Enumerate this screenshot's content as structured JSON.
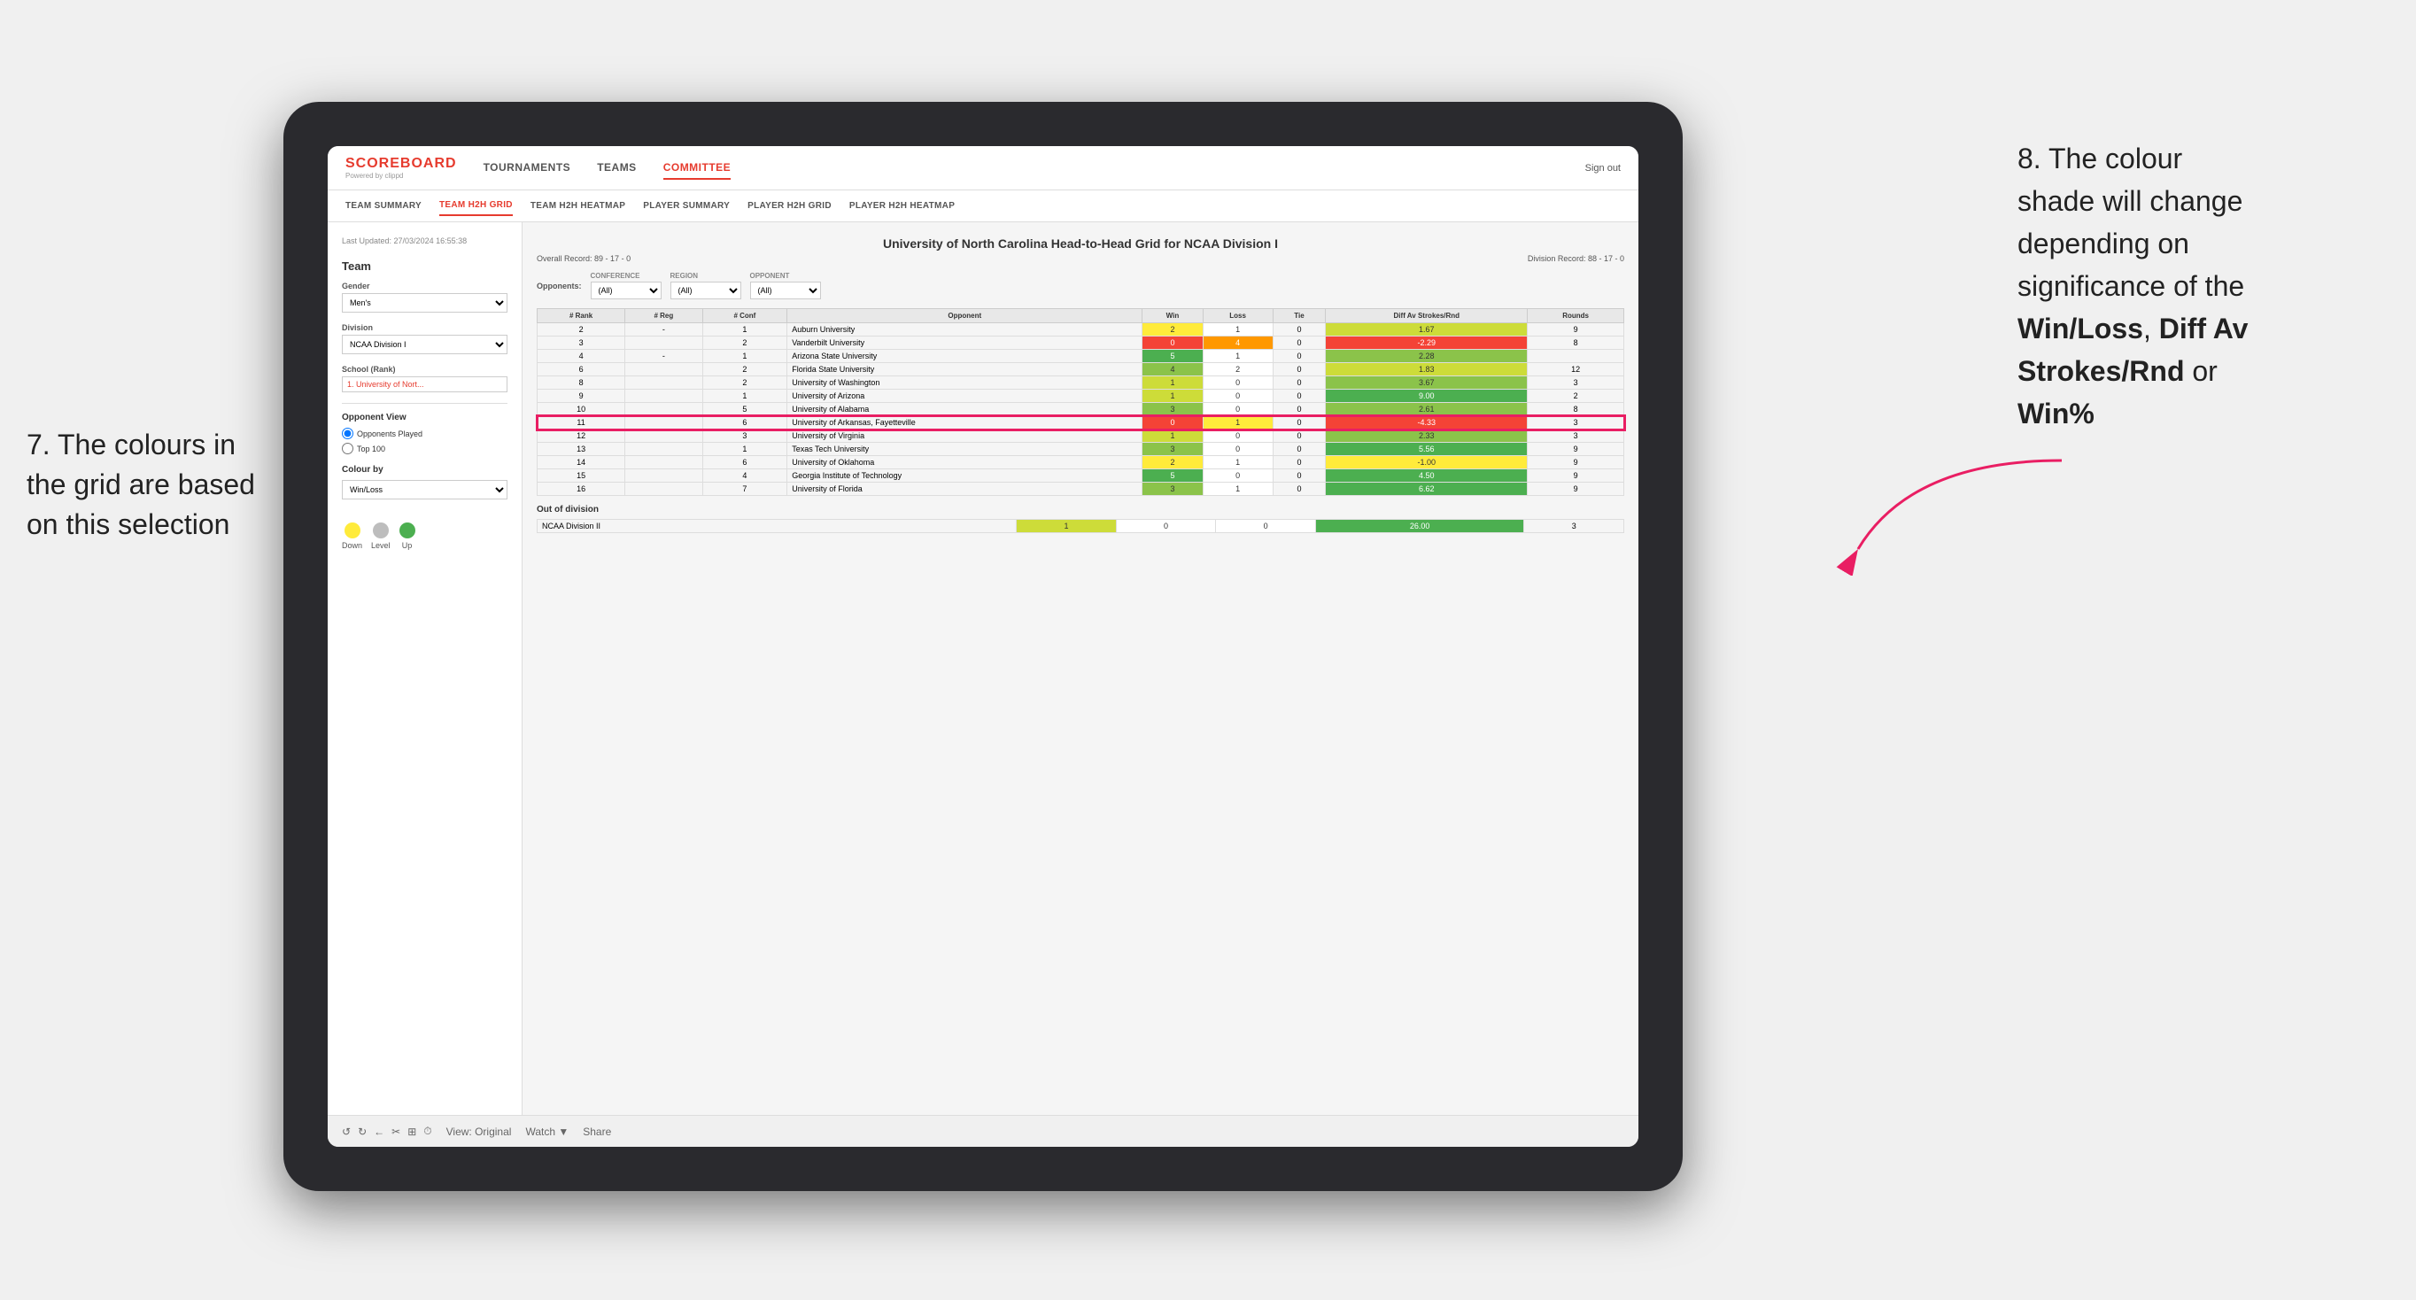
{
  "annotations": {
    "left": {
      "line1": "7. The colours in",
      "line2": "the grid are based",
      "line3": "on this selection"
    },
    "right": {
      "number": "8. The colour",
      "line1": "shade will change",
      "line2": "depending on",
      "line3": "significance of the",
      "bold1": "Win/Loss",
      "comma": ", ",
      "bold2": "Diff Av",
      "bold3": "Strokes/Rnd",
      "or": " or",
      "bold4": "Win%"
    }
  },
  "nav": {
    "logo": "SCOREBOARD",
    "logo_sub": "Powered by clippd",
    "items": [
      "TOURNAMENTS",
      "TEAMS",
      "COMMITTEE"
    ],
    "sign_out": "Sign out"
  },
  "sub_nav": {
    "items": [
      "TEAM SUMMARY",
      "TEAM H2H GRID",
      "TEAM H2H HEATMAP",
      "PLAYER SUMMARY",
      "PLAYER H2H GRID",
      "PLAYER H2H HEATMAP"
    ],
    "active": "TEAM H2H GRID"
  },
  "sidebar": {
    "meta": "Last Updated: 27/03/2024\n16:55:38",
    "team_section": "Team",
    "gender_label": "Gender",
    "gender_value": "Men's",
    "division_label": "Division",
    "division_value": "NCAA Division I",
    "school_label": "School (Rank)",
    "school_value": "1. University of Nort...",
    "opponent_view": "Opponent View",
    "opponents_played": "Opponents Played",
    "top_100": "Top 100",
    "colour_by": "Colour by",
    "colour_value": "Win/Loss",
    "legend_down": "Down",
    "legend_level": "Level",
    "legend_up": "Up"
  },
  "grid": {
    "title": "University of North Carolina Head-to-Head Grid for NCAA Division I",
    "overall_record_label": "Overall Record:",
    "overall_record": "89 - 17 - 0",
    "division_record_label": "Division Record:",
    "division_record": "88 - 17 - 0",
    "filter_opponents_label": "Opponents:",
    "filter_conference_label": "Conference",
    "filter_conference_value": "(All)",
    "filter_region_label": "Region",
    "filter_region_value": "(All)",
    "filter_opponent_label": "Opponent",
    "filter_opponent_value": "(All)",
    "columns": [
      "# Rank",
      "# Reg",
      "# Conf",
      "Opponent",
      "Win",
      "Loss",
      "Tie",
      "Diff Av Strokes/Rnd",
      "Rounds"
    ],
    "rows": [
      {
        "rank": "2",
        "reg": "-",
        "conf": "1",
        "opponent": "Auburn University",
        "win": "2",
        "loss": "1",
        "tie": "0",
        "diff": "1.67",
        "rounds": "9",
        "win_color": "yellow",
        "loss_color": "white",
        "diff_color": "green_light"
      },
      {
        "rank": "3",
        "reg": "",
        "conf": "2",
        "opponent": "Vanderbilt University",
        "win": "0",
        "loss": "4",
        "tie": "0",
        "diff": "-2.29",
        "rounds": "8",
        "win_color": "red",
        "loss_color": "orange",
        "diff_color": "red"
      },
      {
        "rank": "4",
        "reg": "-",
        "conf": "1",
        "opponent": "Arizona State University",
        "win": "5",
        "loss": "1",
        "tie": "0",
        "diff": "2.28",
        "rounds": "",
        "win_color": "green_dark",
        "loss_color": "white",
        "diff_color": "green_med"
      },
      {
        "rank": "6",
        "reg": "",
        "conf": "2",
        "opponent": "Florida State University",
        "win": "4",
        "loss": "2",
        "tie": "0",
        "diff": "1.83",
        "rounds": "12",
        "win_color": "green_med",
        "loss_color": "white",
        "diff_color": "green_light"
      },
      {
        "rank": "8",
        "reg": "",
        "conf": "2",
        "opponent": "University of Washington",
        "win": "1",
        "loss": "0",
        "tie": "0",
        "diff": "3.67",
        "rounds": "3",
        "win_color": "green_light",
        "loss_color": "white",
        "diff_color": "green_med"
      },
      {
        "rank": "9",
        "reg": "",
        "conf": "1",
        "opponent": "University of Arizona",
        "win": "1",
        "loss": "0",
        "tie": "0",
        "diff": "9.00",
        "rounds": "2",
        "win_color": "green_light",
        "loss_color": "white",
        "diff_color": "green_dark"
      },
      {
        "rank": "10",
        "reg": "",
        "conf": "5",
        "opponent": "University of Alabama",
        "win": "3",
        "loss": "0",
        "tie": "0",
        "diff": "2.61",
        "rounds": "8",
        "win_color": "green_med",
        "loss_color": "white",
        "diff_color": "green_med"
      },
      {
        "rank": "11",
        "reg": "",
        "conf": "6",
        "opponent": "University of Arkansas, Fayetteville",
        "win": "0",
        "loss": "1",
        "tie": "0",
        "diff": "-4.33",
        "rounds": "3",
        "win_color": "red",
        "loss_color": "yellow",
        "diff_color": "red",
        "highlighted": true
      },
      {
        "rank": "12",
        "reg": "",
        "conf": "3",
        "opponent": "University of Virginia",
        "win": "1",
        "loss": "0",
        "tie": "0",
        "diff": "2.33",
        "rounds": "3",
        "win_color": "green_light",
        "loss_color": "white",
        "diff_color": "green_med"
      },
      {
        "rank": "13",
        "reg": "",
        "conf": "1",
        "opponent": "Texas Tech University",
        "win": "3",
        "loss": "0",
        "tie": "0",
        "diff": "5.56",
        "rounds": "9",
        "win_color": "green_med",
        "loss_color": "white",
        "diff_color": "green_dark"
      },
      {
        "rank": "14",
        "reg": "",
        "conf": "6",
        "opponent": "University of Oklahoma",
        "win": "2",
        "loss": "1",
        "tie": "0",
        "diff": "-1.00",
        "rounds": "9",
        "win_color": "yellow",
        "loss_color": "white",
        "diff_color": "yellow"
      },
      {
        "rank": "15",
        "reg": "",
        "conf": "4",
        "opponent": "Georgia Institute of Technology",
        "win": "5",
        "loss": "0",
        "tie": "0",
        "diff": "4.50",
        "rounds": "9",
        "win_color": "green_dark",
        "loss_color": "white",
        "diff_color": "green_dark"
      },
      {
        "rank": "16",
        "reg": "",
        "conf": "7",
        "opponent": "University of Florida",
        "win": "3",
        "loss": "1",
        "tie": "0",
        "diff": "6.62",
        "rounds": "9",
        "win_color": "green_med",
        "loss_color": "white",
        "diff_color": "green_dark"
      }
    ],
    "out_of_division_label": "Out of division",
    "out_of_division_row": {
      "division": "NCAA Division II",
      "win": "1",
      "loss": "0",
      "tie": "0",
      "diff": "26.00",
      "rounds": "3",
      "win_color": "green_light",
      "diff_color": "green_dark"
    }
  },
  "toolbar": {
    "view_label": "View: Original",
    "watch_label": "Watch ▼",
    "share_label": "Share"
  }
}
